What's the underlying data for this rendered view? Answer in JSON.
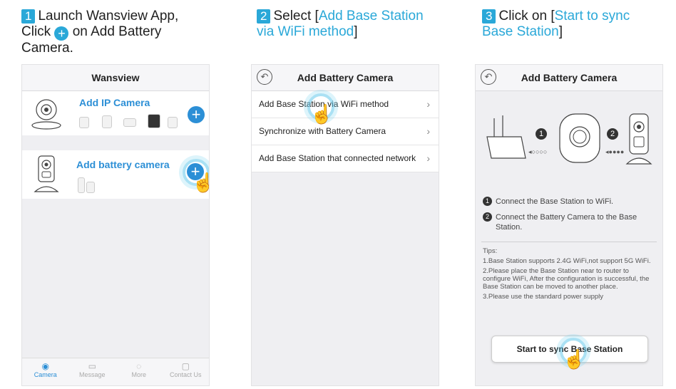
{
  "colors": {
    "accent": "#2aa8d8",
    "brand_blue": "#2c8fd6",
    "screen_bg": "#efeff2"
  },
  "step1": {
    "num": "1",
    "line1": "Launch Wansview App,",
    "line2_a": "Click",
    "line2_b": "on Add Battery",
    "line3": "Camera.",
    "plus_icon": "plus-circle-icon",
    "screen": {
      "title": "Wansview",
      "ip_card_title": "Add IP Camera",
      "battery_card_title": "Add battery camera",
      "tabs": [
        {
          "label": "Camera",
          "icon": "camera-icon"
        },
        {
          "label": "Message",
          "icon": "message-icon"
        },
        {
          "label": "More",
          "icon": "more-icon"
        },
        {
          "label": "Contact Us",
          "icon": "contact-icon"
        }
      ]
    }
  },
  "step2": {
    "num": "2",
    "text": "Select [",
    "highlight": "Add Base Station via WiFi method",
    "close": "]",
    "screen": {
      "title": "Add Battery Camera",
      "menu": [
        "Add Base Station via WiFi method",
        "Synchronize with Battery Camera",
        "Add Base Station that connected network"
      ]
    }
  },
  "step3": {
    "num": "3",
    "text": "Click on [",
    "highlight": "Start to sync Base Station",
    "close": "]",
    "screen": {
      "title": "Add Battery Camera",
      "badge1": "1",
      "badge2": "2",
      "instr1": "Connect the Base Station to WiFi.",
      "instr2": "Connect the Battery Camera to the Base Station.",
      "tips_label": "Tips:",
      "tip1": "1.Base Station supports 2.4G WiFi,not support 5G WiFi.",
      "tip2": "2.Please place the Base Station near to router to configure WiFi, After the configuration is successful, the Base Station can be moved to another place.",
      "tip3": "3.Please use the standard power supply",
      "button": "Start to sync Base Station"
    }
  }
}
